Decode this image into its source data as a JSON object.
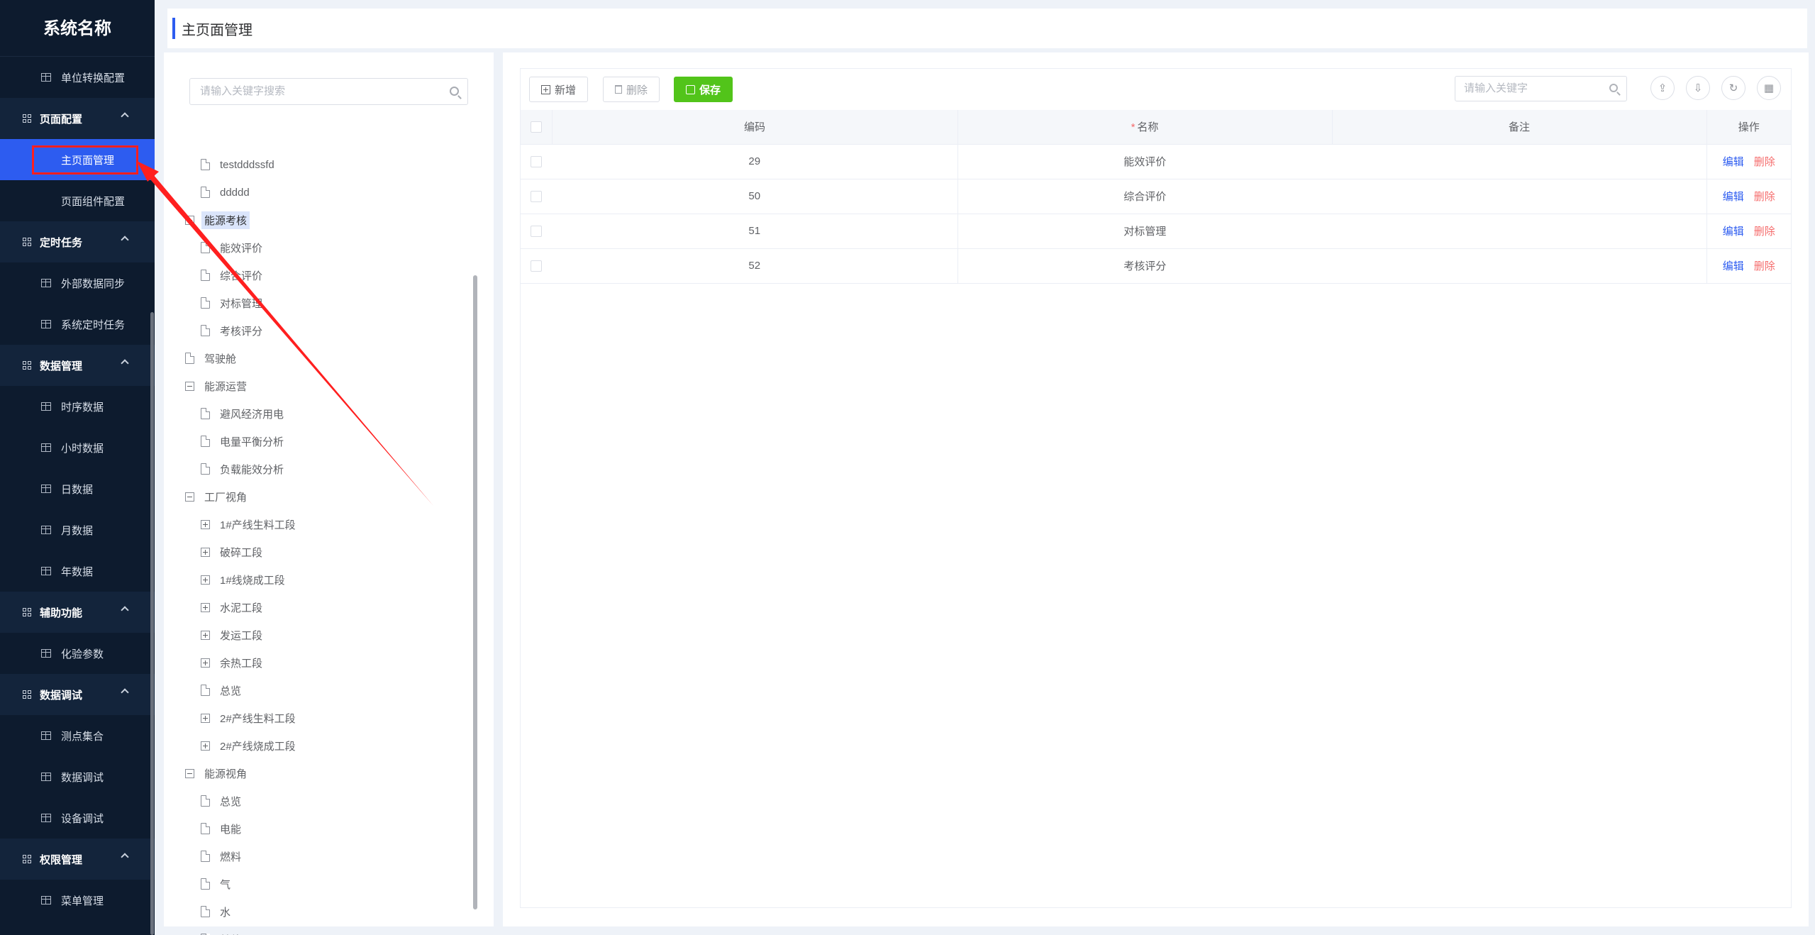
{
  "app": {
    "title": "系统名称"
  },
  "sidebar": {
    "entries": [
      {
        "kind": "item",
        "label": "单位转换配置"
      },
      {
        "kind": "group",
        "label": "页面配置"
      },
      {
        "kind": "item",
        "label": "主页面管理",
        "active": true
      },
      {
        "kind": "item",
        "label": "页面组件配置",
        "noicon": true
      },
      {
        "kind": "group",
        "label": "定时任务"
      },
      {
        "kind": "item",
        "label": "外部数据同步"
      },
      {
        "kind": "item",
        "label": "系统定时任务"
      },
      {
        "kind": "group",
        "label": "数据管理"
      },
      {
        "kind": "item",
        "label": "时序数据"
      },
      {
        "kind": "item",
        "label": "小时数据"
      },
      {
        "kind": "item",
        "label": "日数据"
      },
      {
        "kind": "item",
        "label": "月数据"
      },
      {
        "kind": "item",
        "label": "年数据"
      },
      {
        "kind": "group",
        "label": "辅助功能"
      },
      {
        "kind": "item",
        "label": "化验参数"
      },
      {
        "kind": "group",
        "label": "数据调试"
      },
      {
        "kind": "item",
        "label": "测点集合"
      },
      {
        "kind": "item",
        "label": "数据调试"
      },
      {
        "kind": "item",
        "label": "设备调试"
      },
      {
        "kind": "group",
        "label": "权限管理"
      },
      {
        "kind": "item",
        "label": "菜单管理"
      }
    ]
  },
  "header": {
    "title": "主页面管理"
  },
  "tree": {
    "search_placeholder": "请输入关键字搜索",
    "nodes": [
      {
        "label": "testdddssfd",
        "level": 1,
        "icon": "file"
      },
      {
        "label": "ddddd",
        "level": 1,
        "icon": "file"
      },
      {
        "label": "能源考核",
        "level": 0,
        "icon": "minus",
        "highlight": true
      },
      {
        "label": "能效评价",
        "level": 1,
        "icon": "file"
      },
      {
        "label": "综合评价",
        "level": 1,
        "icon": "file"
      },
      {
        "label": "对标管理",
        "level": 1,
        "icon": "file"
      },
      {
        "label": "考核评分",
        "level": 1,
        "icon": "file"
      },
      {
        "label": "驾驶舱",
        "level": 0,
        "icon": "file"
      },
      {
        "label": "能源运营",
        "level": 0,
        "icon": "minus"
      },
      {
        "label": "避风经济用电",
        "level": 1,
        "icon": "file"
      },
      {
        "label": "电量平衡分析",
        "level": 1,
        "icon": "file"
      },
      {
        "label": "负载能效分析",
        "level": 1,
        "icon": "file"
      },
      {
        "label": "工厂视角",
        "level": 0,
        "icon": "minus"
      },
      {
        "label": "1#产线生料工段",
        "level": 1,
        "icon": "plus"
      },
      {
        "label": "破碎工段",
        "level": 1,
        "icon": "plus"
      },
      {
        "label": "1#线烧成工段",
        "level": 1,
        "icon": "plus"
      },
      {
        "label": "水泥工段",
        "level": 1,
        "icon": "plus"
      },
      {
        "label": "发运工段",
        "level": 1,
        "icon": "plus"
      },
      {
        "label": "余热工段",
        "level": 1,
        "icon": "plus"
      },
      {
        "label": "总览",
        "level": 1,
        "icon": "file"
      },
      {
        "label": "2#产线生料工段",
        "level": 1,
        "icon": "plus"
      },
      {
        "label": "2#产线烧成工段",
        "level": 1,
        "icon": "plus"
      },
      {
        "label": "能源视角",
        "level": 0,
        "icon": "minus"
      },
      {
        "label": "总览",
        "level": 1,
        "icon": "file"
      },
      {
        "label": "电能",
        "level": 1,
        "icon": "file"
      },
      {
        "label": "燃料",
        "level": 1,
        "icon": "file"
      },
      {
        "label": "气",
        "level": 1,
        "icon": "file"
      },
      {
        "label": "水",
        "level": 1,
        "icon": "file"
      },
      {
        "label": "其他",
        "level": 1,
        "icon": "file"
      }
    ]
  },
  "toolbar": {
    "add_label": "新增",
    "delete_label": "删除",
    "save_label": "保存",
    "search_placeholder": "请输入关键字",
    "icons": [
      "upload-icon",
      "download-icon",
      "refresh-icon",
      "columns-icon"
    ]
  },
  "table": {
    "columns": {
      "code": "编码",
      "name": "名称",
      "remark": "备注",
      "action": "操作"
    },
    "rows": [
      {
        "code": "29",
        "name": "能效评价",
        "remark": ""
      },
      {
        "code": "50",
        "name": "综合评价",
        "remark": ""
      },
      {
        "code": "51",
        "name": "对标管理",
        "remark": ""
      },
      {
        "code": "52",
        "name": "考核评分",
        "remark": ""
      }
    ],
    "edit_label": "编辑",
    "delete_label": "删除"
  },
  "colors": {
    "accent": "#2d5cf0",
    "sidebar_bg": "#0d1b2e",
    "save_green": "#52c41a",
    "danger": "#f56c6c",
    "annotation": "#ff1f1f"
  }
}
